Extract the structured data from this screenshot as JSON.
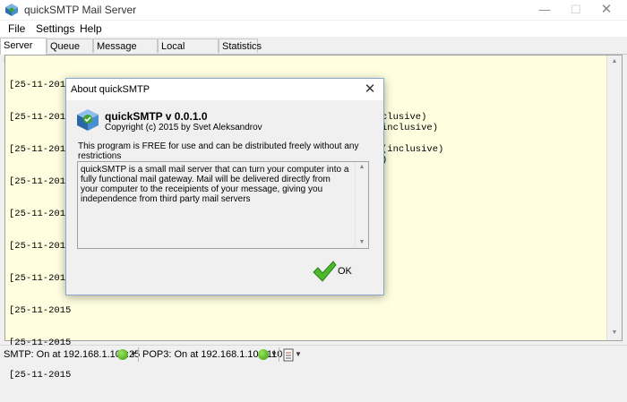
{
  "window": {
    "title": "quickSMTP Mail Server"
  },
  "menu": {
    "items": [
      "File",
      "Settings",
      "Help"
    ]
  },
  "tabs": [
    "Server Log",
    "Queue Log",
    "Message Queue",
    "Local Accounts",
    "Statistics"
  ],
  "active_tab": "Server Log",
  "log": {
    "lines": [
      "[25-11-2015 15:06:30] Starting SMTP on 192.168.1.100:25",
      "[25-11-2015 15:06:30] [SMTP] [0] SMTP server now up and running",
      "[25-11-2015",
      "[25-11-2015",
      "[25-11-2015",
      "[25-11-2015",
      "[25-11-2015",
      "[25-11-2015",
      "[25-11-2015",
      "[25-11-2015"
    ],
    "partial_visible": {
      "line5": "clusive)",
      "line6": "inclusive)",
      "line8": "(inclusive)",
      "line9": ")"
    }
  },
  "status": {
    "smtp": "SMTP: On at 192.168.1.100:25",
    "pop3": "POP3: On at 192.168.1.100:110"
  },
  "dialog": {
    "title": "About quickSMTP",
    "app_name": "quickSMTP  v 0.0.1.0",
    "copyright": "Copyright (c) 2015 by Svet Aleksandrov",
    "free_text": "This program is FREE for use and can be distributed freely without any restrictions",
    "description": "quickSMTP is a small mail server that can turn your computer into a fully functional mail gateway. Mail will be delivered directly from your computer to the receipients of your message, giving you independence from third party mail servers",
    "ok_label": "OK"
  },
  "colors": {
    "log_bg": "#ffffe0",
    "status_on": "#5cc92a",
    "ok_check": "#45b02a"
  }
}
